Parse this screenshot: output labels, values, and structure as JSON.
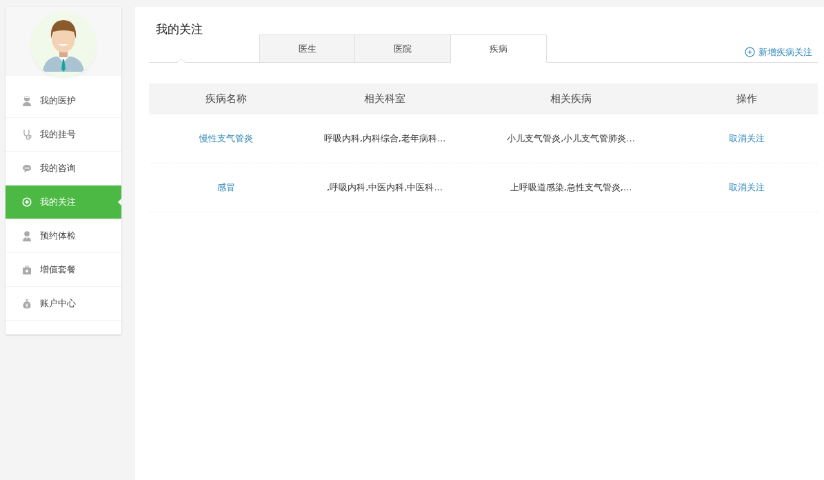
{
  "sidebar": {
    "items": [
      {
        "label": "我的医护",
        "selected": false
      },
      {
        "label": "我的挂号",
        "selected": false
      },
      {
        "label": "我的咨询",
        "selected": false
      },
      {
        "label": "我的关注",
        "selected": true
      },
      {
        "label": "预约体检",
        "selected": false
      },
      {
        "label": "增值套餐",
        "selected": false
      },
      {
        "label": "账户中心",
        "selected": false
      }
    ]
  },
  "page_title": "我的关注",
  "tabs": [
    {
      "label": "医生",
      "selected": false
    },
    {
      "label": "医院",
      "selected": false
    },
    {
      "label": "疾病",
      "selected": true
    }
  ],
  "add_link": "新增疾病关注",
  "table": {
    "columns": [
      "疾病名称",
      "相关科室",
      "相关疾病",
      "操作"
    ],
    "rows": [
      {
        "name": "慢性支气管炎",
        "departments": "呼吸内科,内科综合,老年病科...",
        "diseases": "小儿支气管炎,小儿支气管肺炎...",
        "action": "取消关注"
      },
      {
        "name": "感冒",
        "departments": ",呼吸内科,中医内科,中医科...",
        "diseases": "上呼吸道感染,急性支气管炎,...",
        "action": "取消关注"
      }
    ]
  }
}
